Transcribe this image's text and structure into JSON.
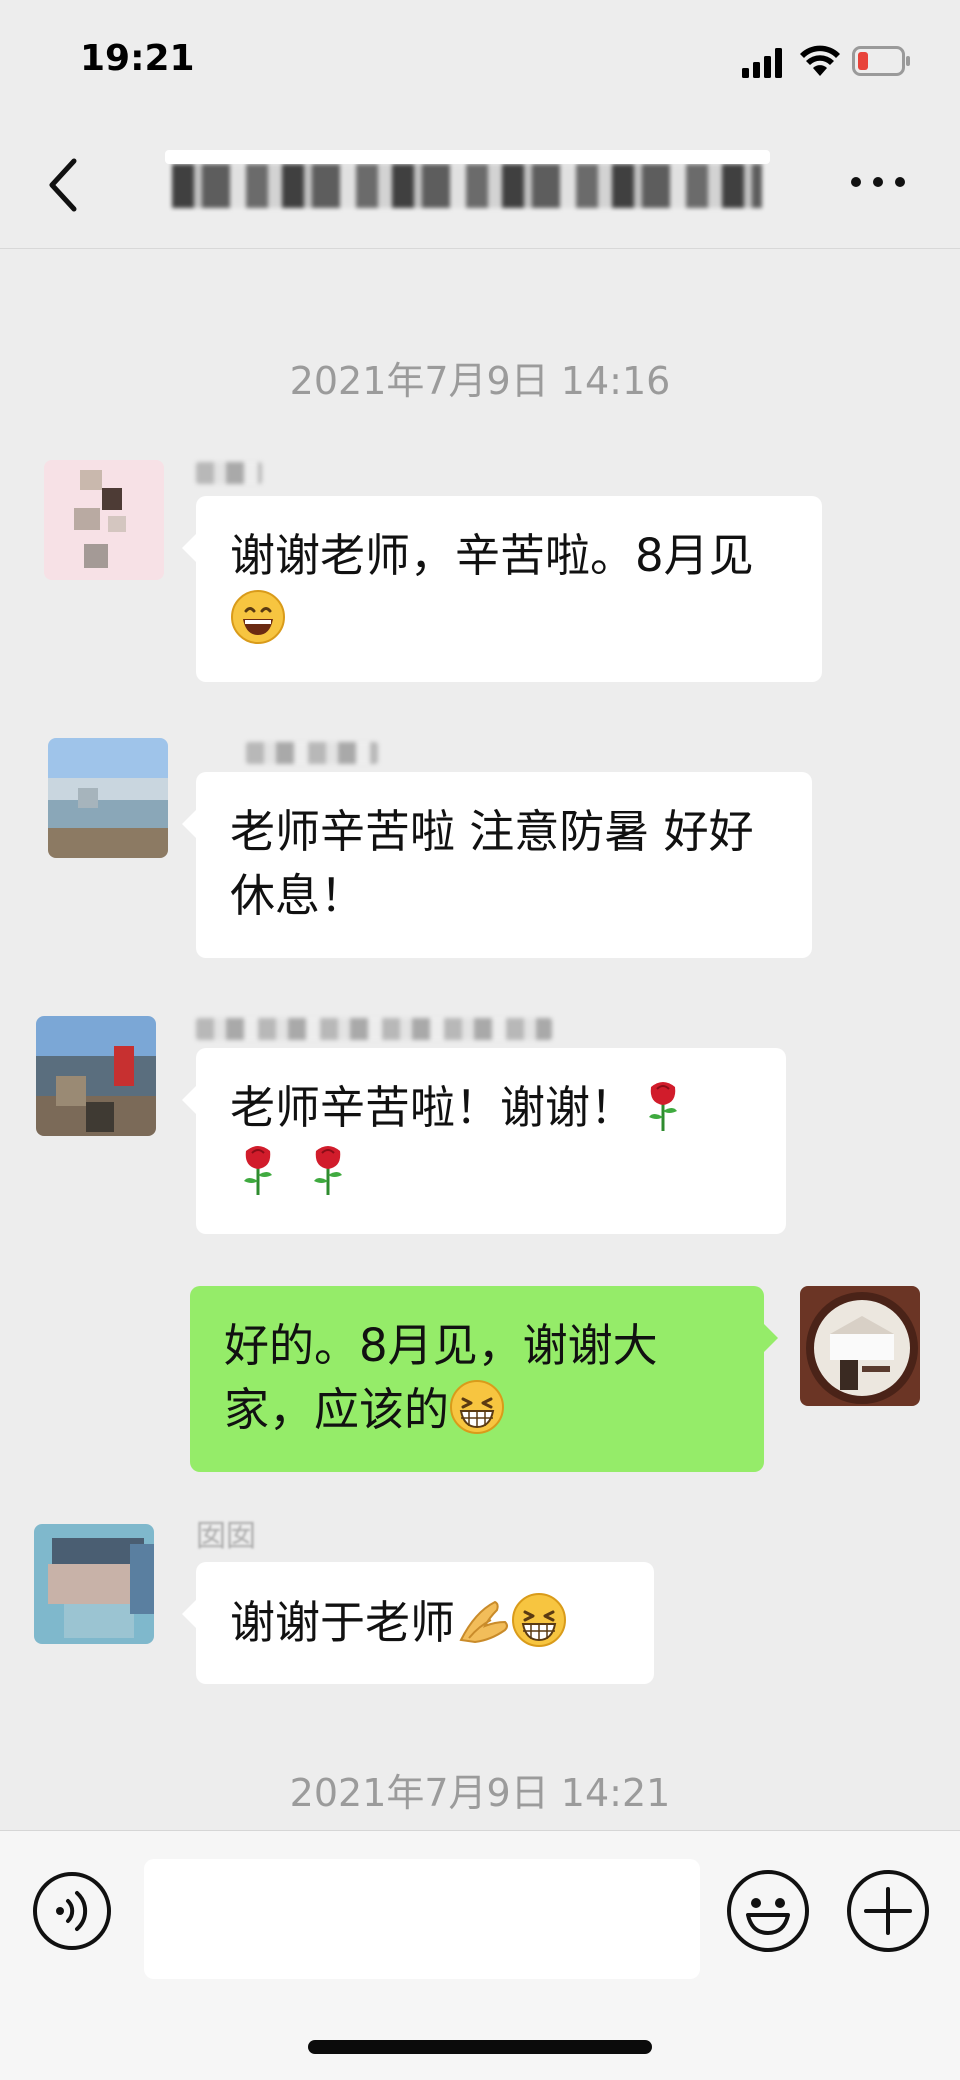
{
  "status_bar": {
    "time": "19:21",
    "battery_color": "#e8433a"
  },
  "nav": {
    "title_blurred": true,
    "back_icon": "chevron-left-icon",
    "more_icon": "ellipsis-icon"
  },
  "timestamps": {
    "first": "2021年7月9日 14:16",
    "last": "2021年7月9日 14:21"
  },
  "messages": [
    {
      "side": "left",
      "name": "",
      "text": "谢谢老师，辛苦啦。8月见",
      "emoji": [
        "grinning-face-icon"
      ]
    },
    {
      "side": "left",
      "name": "",
      "text": "老师辛苦啦 注意防暑 好好休息！",
      "emoji": []
    },
    {
      "side": "left",
      "name": "",
      "text": "老师辛苦啦！谢谢！",
      "emoji": [
        "rose-icon",
        "rose-icon",
        "rose-icon"
      ]
    },
    {
      "side": "right",
      "name": "",
      "text": "好的。8月见，谢谢大家，应该的",
      "emoji": [
        "grinning-squinting-face-icon"
      ]
    },
    {
      "side": "left",
      "name": "囡囡",
      "text": "谢谢于老师",
      "emoji": [
        "folded-hands-icon",
        "grinning-squinting-face-icon"
      ]
    }
  ],
  "input_bar": {
    "voice_icon": "voice-icon",
    "emoji_icon": "smiley-icon",
    "plus_icon": "plus-circle-icon",
    "placeholder": ""
  },
  "colors": {
    "background": "#ededed",
    "bubble_self": "#95ec69",
    "bubble_other": "#ffffff"
  }
}
